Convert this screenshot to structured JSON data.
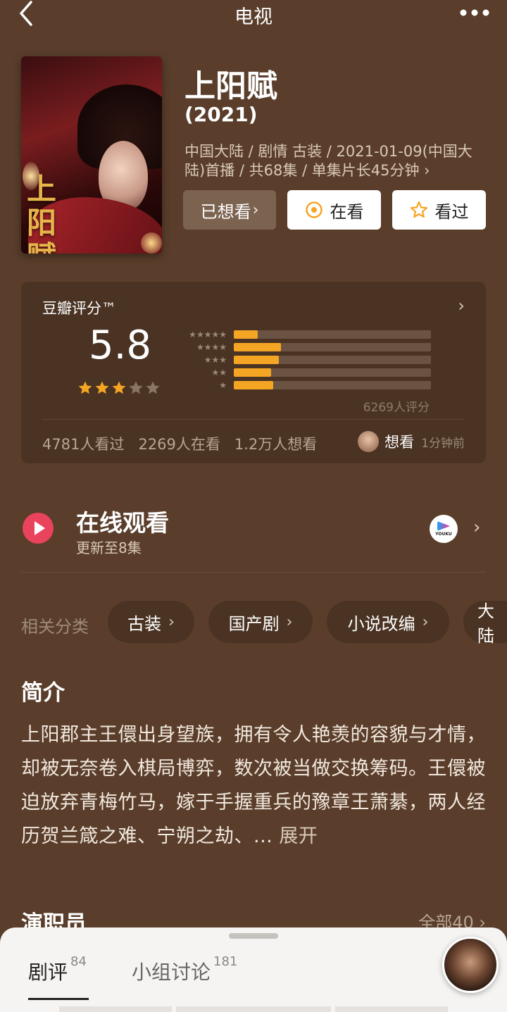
{
  "header": {
    "title": "电视"
  },
  "subject": {
    "poster_title": "上阳赋",
    "title": "上阳赋",
    "year": "(2021)",
    "meta": "中国大陆 / 剧情 古装 / 2021-01-09(中国大陆)首播 / 共68集 / 单集片长45分钟 ›"
  },
  "actions": {
    "wish_label": "已想看",
    "wish_chevron": "›",
    "watching_label": "在看",
    "watched_label": "看过"
  },
  "rating": {
    "label": "豆瓣评分™",
    "chevron": "›",
    "score": "5.8",
    "stars_filled": 3,
    "stars_total": 5,
    "distribution": [
      {
        "stars": 5,
        "fraction": 0.12
      },
      {
        "stars": 4,
        "fraction": 0.24
      },
      {
        "stars": 3,
        "fraction": 0.23
      },
      {
        "stars": 2,
        "fraction": 0.19
      },
      {
        "stars": 1,
        "fraction": 0.2
      }
    ],
    "count": "6269人评分",
    "watched": "4781人看过",
    "watching": "2269人在看",
    "wish": "1.2万人想看",
    "activity_action": "想看",
    "activity_time": "1分钟前",
    "bar_color": "#f5a524"
  },
  "online": {
    "title": "在线观看",
    "subtitle": "更新至8集",
    "provider": "YOUKU",
    "chevron": "›"
  },
  "categories": {
    "label": "相关分类",
    "chips": [
      "古装",
      "国产剧",
      "小说改编",
      "大陆"
    ]
  },
  "synopsis": {
    "title": "简介",
    "text": "上阳郡主王儇出身望族，拥有令人艳羡的容貌与才情，却被无奈卷入棋局博弈，数次被当做交换筹码。王儇被迫放弃青梅竹马，嫁于手握重兵的豫章王萧綦，两人经历贺兰箴之难、宁朔之劫、... ",
    "expand": "展开"
  },
  "cast": {
    "title": "演职员",
    "all": "全部40 ›"
  },
  "sheet": {
    "tabs": [
      {
        "label": "剧评",
        "count": "84"
      },
      {
        "label": "小组讨论",
        "count": "181"
      }
    ]
  }
}
